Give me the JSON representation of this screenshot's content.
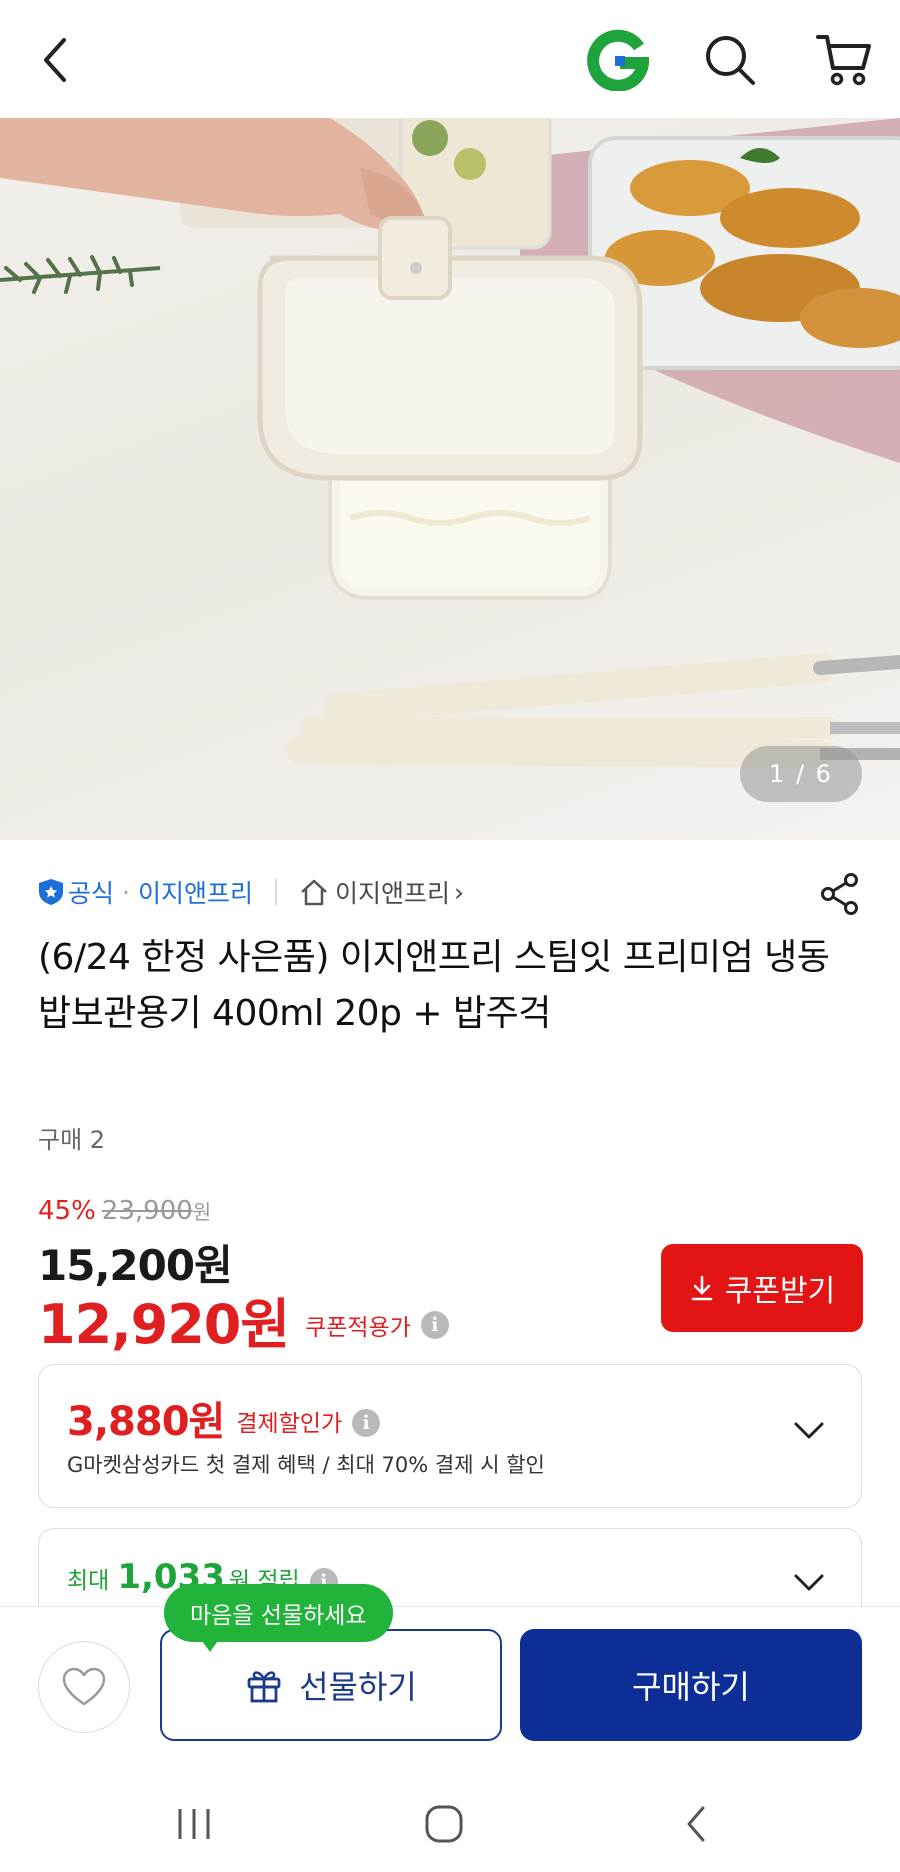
{
  "header": {
    "back_icon": "chevron-left-icon",
    "brand_logo": "G",
    "brand_color": "#1ea43a",
    "search_icon": "search-icon",
    "cart_icon": "cart-icon"
  },
  "product_image": {
    "counter": "1 / 6",
    "current": 1,
    "total": 6
  },
  "seller": {
    "official_label": "공식",
    "separator": "·",
    "name": "이지앤프리",
    "store_link_label": "이지앤프리",
    "store_link_arrow": "›"
  },
  "product": {
    "title": "(6/24 한정 사은품) 이지앤프리 스팀잇 프리미엄 냉동밥보관용기 400ml 20p + 밥주걱",
    "purchase_count": "구매 2"
  },
  "pricing": {
    "discount_rate": "45%",
    "original_price": "23,900",
    "original_unit": "원",
    "sale_price": "15,200원",
    "coupon_price": "12,920원",
    "coupon_price_label": "쿠폰적용가",
    "coupon_button_label": "쿠폰받기",
    "accent_color": "#e02020"
  },
  "payment_discount": {
    "amount": "3,880원",
    "label": "결제할인가",
    "description": "G마켓삼성카드 첫 결제 혜택 / 최대 70% 결제 시 할인"
  },
  "reward": {
    "prefix": "최대",
    "amount": "1,033",
    "unit": "원 적립"
  },
  "actions": {
    "tooltip": "마음을 선물하세요",
    "gift_label": "선물하기",
    "buy_label": "구매하기",
    "buy_color": "#0d2e96"
  },
  "system_nav": {
    "recent_icon": "recent-apps-icon",
    "home_icon": "home-icon",
    "back_icon": "back-icon"
  }
}
